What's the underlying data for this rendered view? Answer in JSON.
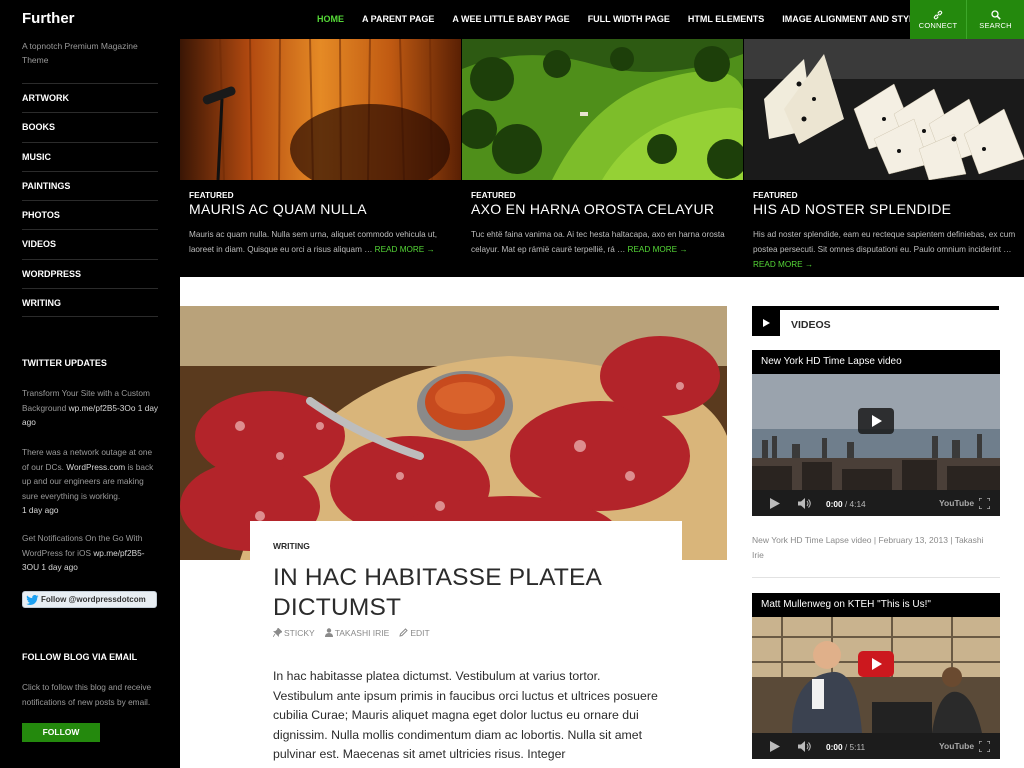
{
  "site": {
    "title": "Further",
    "description": "A topnotch Premium Magazine Theme"
  },
  "nav": {
    "items": [
      {
        "label": "HOME",
        "current": true
      },
      {
        "label": "A PARENT PAGE"
      },
      {
        "label": "A WEE LITTLE BABY PAGE"
      },
      {
        "label": "FULL WIDTH PAGE"
      },
      {
        "label": "HTML ELEMENTS"
      },
      {
        "label": "IMAGE ALIGNMENT AND STYLES"
      }
    ],
    "connect_label": "CONNECT",
    "connect_icon": "link-icon",
    "search_label": "SEARCH",
    "search_icon": "search-icon"
  },
  "sidebar": {
    "categories": [
      "ARTWORK",
      "BOOKS",
      "MUSIC",
      "PAINTINGS",
      "PHOTOS",
      "VIDEOS",
      "WORDPRESS",
      "WRITING"
    ],
    "twitter_heading": "TWITTER UPDATES",
    "tweets": [
      {
        "text": "Transform Your Site with a Custom Background ",
        "link": "wp.me/pf2B5-3Oo",
        "time": "1 day ago"
      },
      {
        "text": "There was a network outage at one of our DCs. ",
        "link": "WordPress.com",
        "text2": " is back up and our engineers are making sure everything is working.",
        "time": "1 day ago"
      },
      {
        "text": "Get Notifications On the Go With WordPress for iOS ",
        "link": "wp.me/pf2B5-3OU",
        "time": "1 day ago"
      }
    ],
    "follow_twitter_label": "Follow @wordpressdotcom",
    "email_heading": "FOLLOW BLOG VIA EMAIL",
    "email_desc": "Click to follow this blog and receive notifications of new posts by email.",
    "follow_button": "FOLLOW"
  },
  "featured": [
    {
      "kicker": "FEATURED",
      "title": "MAURIS AC QUAM NULLA",
      "excerpt": "Mauris ac quam nulla. Nulla sem urna, aliquet commodo vehicula ut, laoreet in diam. Quisque eu orci a risus aliquam … ",
      "read_more": "READ MORE →"
    },
    {
      "kicker": "FEATURED",
      "title": "AXO EN HARNA OROSTA CELAYUR",
      "excerpt": "Tuc ehtë faina vanima oa. Ai tec hesta haltacapa, axo en harna orosta celayur. Mat ep rámië caurë terpellië, rá … ",
      "read_more": "READ MORE →"
    },
    {
      "kicker": "FEATURED",
      "title": "HIS AD NOSTER SPLENDIDE",
      "excerpt": "His ad noster splendide, eam eu recteque sapientem definiebas, ex cum postea persecuti. Sit omnes disputationi eu. Paulo omnium inciderint … ",
      "read_more": "READ MORE →"
    }
  ],
  "post": {
    "category": "WRITING",
    "title": "IN HAC HABITASSE PLATEA DICTUMST",
    "meta": {
      "sticky": "STICKY",
      "author": "TAKASHI IRIE",
      "edit": "EDIT"
    },
    "body": "In hac habitasse platea dictumst. Vestibulum at varius tortor. Vestibulum ante ipsum primis in faucibus orci luctus et ultrices posuere cubilia Curae; Mauris aliquet magna eget dolor luctus eu ornare dui dignissim. Nulla mollis condimentum diam ac lobortis. Nulla sit amet pulvinar est. Maecenas sit amet ultricies risus. Integer"
  },
  "videos_widget": {
    "title": "VIDEOS",
    "videos": [
      {
        "title": "New York HD Time Lapse video",
        "time": "0:00",
        "duration": " / 4:14",
        "logo": "YouTube",
        "caption": "New York HD Time Lapse video | February 13, 2013 | Takashi Irie"
      },
      {
        "title": "Matt Mullenweg on KTEH \"This is Us!\"",
        "time": "0:00",
        "duration": " / 5:11",
        "logo": "YouTube"
      }
    ]
  },
  "colors": {
    "accent": "#24890d",
    "accent_light": "#55d737",
    "background_dark": "#000000"
  }
}
